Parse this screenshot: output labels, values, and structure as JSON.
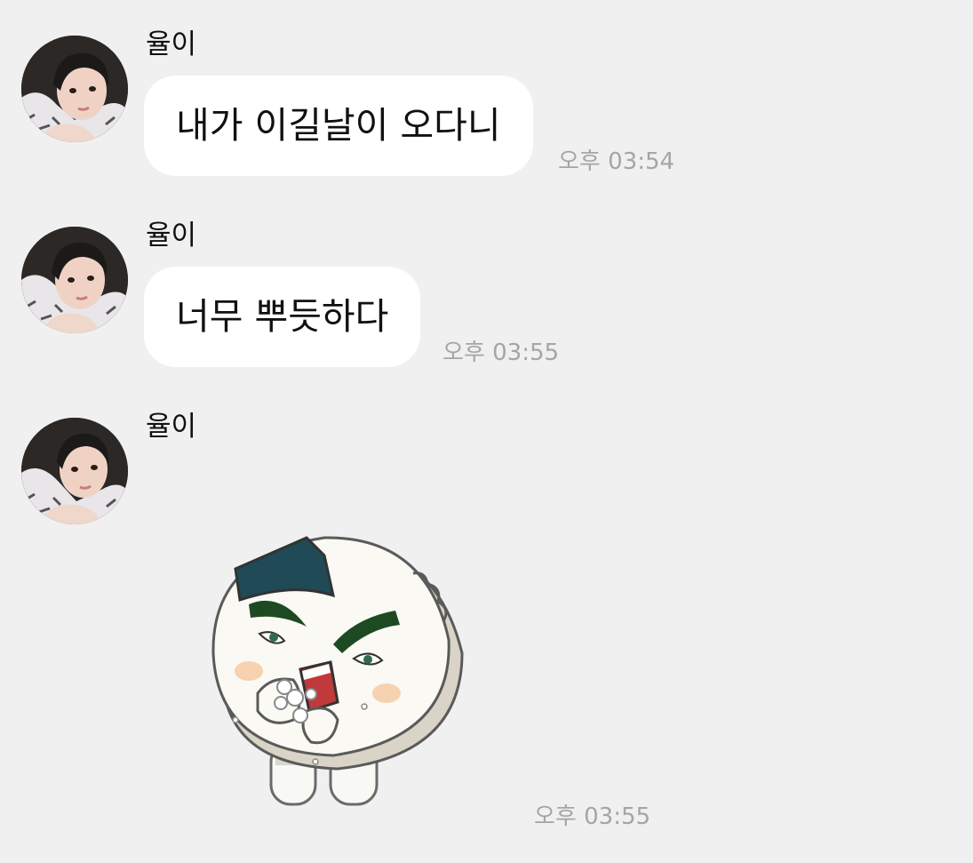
{
  "chat": {
    "messages": [
      {
        "sender": "율이",
        "type": "text",
        "text": "내가 이길날이 오다니",
        "time": "오후 03:54"
      },
      {
        "sender": "율이",
        "type": "text",
        "text": "너무 뿌듯하다",
        "time": "오후 03:55"
      },
      {
        "sender": "율이",
        "type": "sticker",
        "sticker_icon": "rice-ball-eating-sticker",
        "time": "오후 03:55"
      }
    ]
  },
  "colors": {
    "background": "#f0f0f0",
    "bubble": "#ffffff",
    "timestamp": "#a5a5a5"
  }
}
